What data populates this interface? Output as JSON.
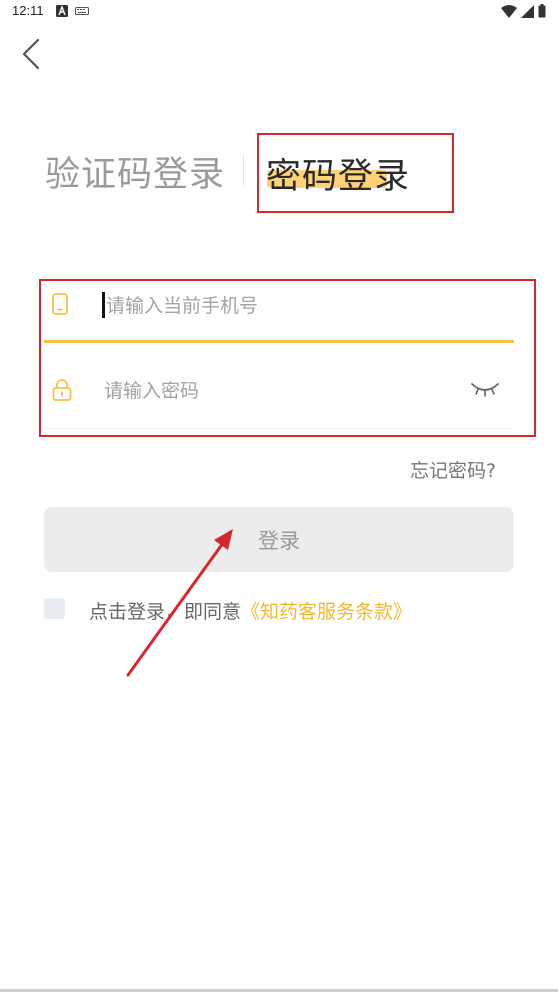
{
  "status_bar": {
    "time": "12:11",
    "icons": [
      "a-notification-icon",
      "keyboard-icon",
      "wifi-icon",
      "signal-icon",
      "battery-icon"
    ]
  },
  "tabs": {
    "sms_label": "验证码登录",
    "password_label": "密码登录",
    "active": "password"
  },
  "form": {
    "phone_placeholder": "请输入当前手机号",
    "phone_value": "",
    "password_placeholder": "请输入密码",
    "password_value": ""
  },
  "forgot_label": "忘记密码?",
  "login_label": "登录",
  "agreement": {
    "checked": false,
    "prefix": "点击登录，即同意",
    "terms_link": "《知药客服务条款》"
  },
  "colors": {
    "accent": "#f5c243",
    "annotation_red": "#d9262c",
    "tab_highlight": "#ffd27a"
  }
}
